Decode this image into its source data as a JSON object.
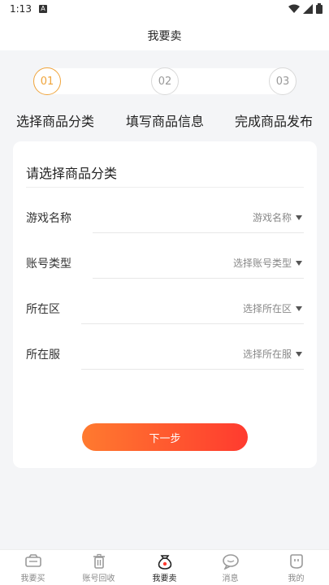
{
  "status": {
    "time": "1:13",
    "notif_glyph": "A"
  },
  "header": {
    "title": "我要卖"
  },
  "steps": [
    {
      "num": "01",
      "label": "选择商品分类",
      "active": true
    },
    {
      "num": "02",
      "label": "填写商品信息",
      "active": false
    },
    {
      "num": "03",
      "label": "完成商品发布",
      "active": false
    }
  ],
  "card": {
    "title": "请选择商品分类",
    "rows": [
      {
        "label": "游戏名称",
        "value": "游戏名称"
      },
      {
        "label": "账号类型",
        "value": "选择账号类型"
      },
      {
        "label": "所在区",
        "value": "选择所在区"
      },
      {
        "label": "所在服",
        "value": "选择所在服"
      }
    ],
    "next_label": "下一步"
  },
  "tabbar": {
    "items": [
      {
        "label": "我要买",
        "icon": "ticket-icon"
      },
      {
        "label": "账号回收",
        "icon": "trash-icon"
      },
      {
        "label": "我要卖",
        "icon": "money-bag-icon",
        "active": true
      },
      {
        "label": "消息",
        "icon": "chat-icon"
      },
      {
        "label": "我的",
        "icon": "profile-icon"
      }
    ]
  },
  "colors": {
    "accent": "#f0a43a",
    "button_start": "#ff7a2f",
    "button_end": "#ff3b2f"
  }
}
